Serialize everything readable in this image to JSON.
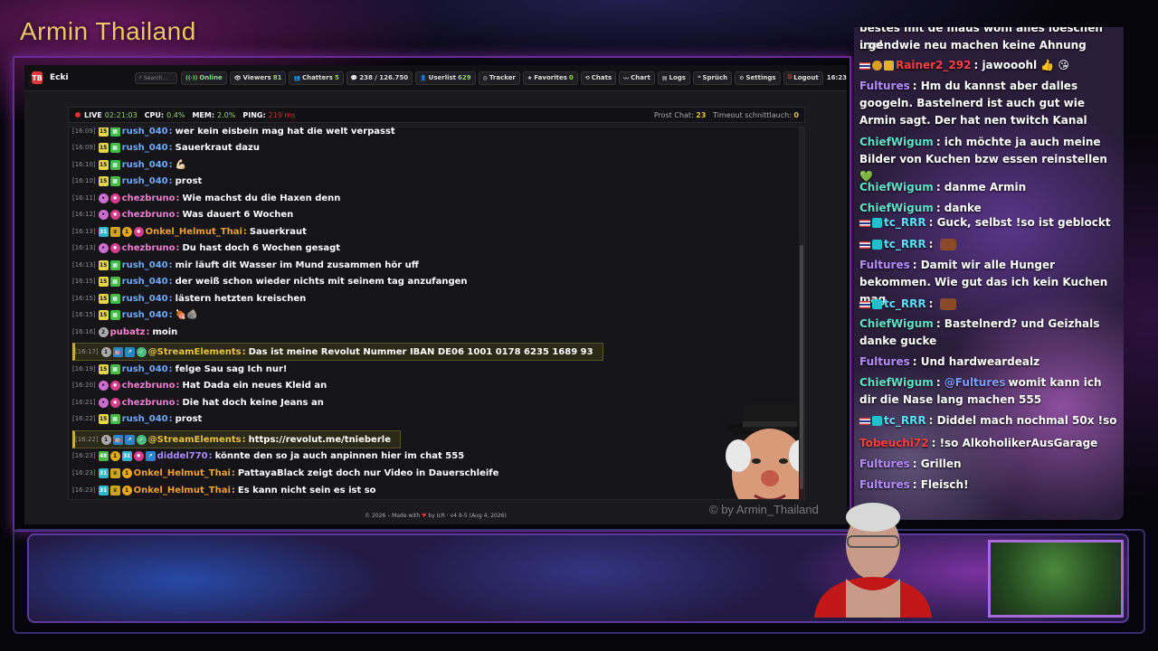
{
  "title": "Armin Thailand",
  "app": {
    "name": "Ecki",
    "logo": "TB",
    "search_placeholder": "Search...",
    "toolbar": [
      {
        "label": "Online",
        "icon": "signal-icon",
        "name": "online"
      },
      {
        "label": "Viewers",
        "value": "81",
        "icon": "eye-icon",
        "name": "viewers"
      },
      {
        "label": "Chatters",
        "value": "5",
        "icon": "users-icon",
        "name": "chatters"
      },
      {
        "label": "238 / 126.750",
        "icon": "chat-icon",
        "name": "messages"
      },
      {
        "label": "Userlist",
        "value": "629",
        "icon": "user-icon",
        "name": "userlist"
      },
      {
        "label": "Tracker",
        "icon": "target-icon",
        "name": "tracker"
      },
      {
        "label": "Favorites",
        "value": "0",
        "icon": "star-icon",
        "name": "favorites"
      },
      {
        "label": "Chats",
        "icon": "history-icon",
        "name": "chats"
      },
      {
        "label": "Chart",
        "icon": "chart-icon",
        "name": "chart"
      },
      {
        "label": "Logs",
        "icon": "file-icon",
        "name": "logs"
      },
      {
        "label": "Sprüch",
        "icon": "quote-icon",
        "name": "sprueche"
      },
      {
        "label": "Settings",
        "icon": "gear-icon",
        "name": "settings"
      },
      {
        "label": "Logout",
        "icon": "logout-icon",
        "name": "logout"
      }
    ],
    "clock": "16:23"
  },
  "status": {
    "live": "LIVE",
    "uptime": "02:21:03",
    "cpu_label": "CPU:",
    "cpu": "0.4%",
    "mem_label": "MEM:",
    "mem": "2.0%",
    "ping_label": "PING:",
    "ping": "219 ms",
    "prost_label": "Prost Chat:",
    "prost": "23",
    "timeout_label": "Timeout schnittlauch:",
    "timeout": "0"
  },
  "chat": [
    {
      "ts": "[16:09]",
      "badges": [
        "sub15",
        "green"
      ],
      "user": "rush_040",
      "color": "#6fa8ff",
      "text": "wer kein eisbein mag hat die welt verpasst"
    },
    {
      "ts": "[16:09]",
      "badges": [
        "sub15",
        "green"
      ],
      "user": "rush_040",
      "color": "#6fa8ff",
      "text": "Sauerkraut dazu"
    },
    {
      "ts": "[16:10]",
      "badges": [
        "sub15",
        "green"
      ],
      "user": "rush_040",
      "color": "#6fa8ff",
      "text": "💪🏻"
    },
    {
      "ts": "[16:10]",
      "badges": [
        "sub15",
        "green"
      ],
      "user": "rush_040",
      "color": "#6fa8ff",
      "text": "prost"
    },
    {
      "ts": "[16:11]",
      "badges": [
        "pink",
        "star"
      ],
      "user": "chezbruno",
      "color": "#ee7fd0",
      "text": "Wie machst du die Haxen denn"
    },
    {
      "ts": "[16:12]",
      "badges": [
        "pink",
        "star"
      ],
      "user": "chezbruno",
      "color": "#ee7fd0",
      "text": "Was dauert 6 Wochen"
    },
    {
      "ts": "[16:13]",
      "badges": [
        "cyan",
        "crown",
        "gold",
        "star"
      ],
      "user": "Onkel_Helmut_Thai",
      "color": "#f0a030",
      "text": "Sauerkraut"
    },
    {
      "ts": "[16:13]",
      "badges": [
        "pink",
        "star"
      ],
      "user": "chezbruno",
      "color": "#ee7fd0",
      "text": "Du hast doch 6 Wochen gesagt"
    },
    {
      "ts": "[16:13]",
      "badges": [
        "sub15",
        "green"
      ],
      "user": "rush_040",
      "color": "#6fa8ff",
      "text": "mir läuft dit Wasser im Mund zusammen hör uff"
    },
    {
      "ts": "[16:15]",
      "badges": [
        "sub15",
        "green"
      ],
      "user": "rush_040",
      "color": "#6fa8ff",
      "text": "der weiß schon wieder nichts mit seinem tag anzufangen"
    },
    {
      "ts": "[16:15]",
      "badges": [
        "sub15",
        "green"
      ],
      "user": "rush_040",
      "color": "#6fa8ff",
      "text": "lästern hetzten kreischen"
    },
    {
      "ts": "[16:15]",
      "badges": [
        "sub15",
        "green"
      ],
      "user": "rush_040",
      "color": "#6fa8ff",
      "text": "🍖🪨"
    },
    {
      "ts": "[16:16]",
      "badges": [
        "gray2"
      ],
      "user": "pubatz",
      "color": "#ff7fd0",
      "text": "moin"
    },
    {
      "ts": "[16:17]",
      "badges": [
        "gray1",
        "blue",
        "blue2",
        "lime"
      ],
      "user": "@StreamElements",
      "color": "#e8c040",
      "text": "Das ist meine Revolut Nummer IBAN DE06 1001 0178 6235 1689 93",
      "hl": true
    },
    {
      "ts": "[16:19]",
      "badges": [
        "sub15",
        "green"
      ],
      "user": "rush_040",
      "color": "#6fa8ff",
      "text": "felge Sau sag Ich nur!"
    },
    {
      "ts": "[16:20]",
      "badges": [
        "pink",
        "star"
      ],
      "user": "chezbruno",
      "color": "#ee7fd0",
      "text": "Hat Dada ein neues Kleid an"
    },
    {
      "ts": "[16:21]",
      "badges": [
        "pink",
        "star"
      ],
      "user": "chezbruno",
      "color": "#ee7fd0",
      "text": "Die hat doch keine Jeans an"
    },
    {
      "ts": "[16:22]",
      "badges": [
        "sub15",
        "green"
      ],
      "user": "rush_040",
      "color": "#6fa8ff",
      "text": "prost"
    },
    {
      "ts": "[16:22]",
      "badges": [
        "gray1",
        "blue",
        "blue2",
        "lime"
      ],
      "user": "@StreamElements",
      "color": "#e8c040",
      "text": "https://revolut.me/tnieberle",
      "hl": true
    },
    {
      "ts": "[16:23]",
      "badges": [
        "green48",
        "gold",
        "cyan",
        "star",
        "blue2"
      ],
      "user": "diddel770",
      "color": "#a98cff",
      "text": "könnte den so ja auch anpinnen hier im chat 555"
    },
    {
      "ts": "[16:23]",
      "badges": [
        "cyan",
        "crown",
        "gold"
      ],
      "user": "Onkel_Helmut_Thai",
      "color": "#f0a030",
      "text": "PattayaBlack zeigt doch nur Video in Dauerschleife"
    },
    {
      "ts": "[16:23]",
      "badges": [
        "cyan",
        "crown",
        "gold"
      ],
      "user": "Onkel_Helmut_Thai",
      "color": "#f0a030",
      "text": "Es kann nicht sein es ist so"
    }
  ],
  "footer": {
    "pre": "© 2026 – Made with",
    "heart": "♥",
    "post": "by IcR · v4.9-5 (Aug 4, 2026)"
  },
  "watermark": "© by Armin_Thailand",
  "side_chat": [
    {
      "user": "",
      "text": "bestes mit de maus wohl alles loeschen und",
      "cut": true
    },
    {
      "user": "",
      "text": "irgendwie neu machen keine Ahnung"
    },
    {
      "user": "Rainer2_292",
      "color": "#ff4040",
      "prefix": "flag-g-y",
      "text": "jawooohl 👍 😘"
    },
    {
      "user": "Fultures",
      "color": "#b58cff",
      "text": "Hm du kannst aber dalles googeln. Bastelnerd ist auch gut wie Armin sagt. Der hat nen twitch Kanal"
    },
    {
      "user": "ChiefWigum",
      "color": "#5fe0c8",
      "text": "ich möchte ja auch meine Bilder von Kuchen bzw essen reinstellen 💚"
    },
    {
      "user": "ChiefWigum",
      "color": "#5fe0c8",
      "text": "danme Armin"
    },
    {
      "user": "ChiefWigum",
      "color": "#5fe0c8",
      "text": "danke"
    },
    {
      "user": "tc_RRR",
      "color": "#5fe0ff",
      "prefix": "flag-c",
      "text": "Guck, selbst !so ist geblockt"
    },
    {
      "user": "tc_RRR",
      "color": "#5fe0ff",
      "prefix": "flag-c",
      "text": "",
      "emote": true
    },
    {
      "user": "Fultures",
      "color": "#b58cff",
      "text": "Damit wir alle Hunger bekommen. Wie gut das ich kein Kuchen mag"
    },
    {
      "user": "tc_RRR",
      "color": "#5fe0ff",
      "prefix": "flag-c",
      "text": "",
      "emote": true
    },
    {
      "user": "ChiefWigum",
      "color": "#5fe0c8",
      "text": "Bastelnerd? und Geizhals danke gucke"
    },
    {
      "user": "Fultures",
      "color": "#b58cff",
      "text": "Und hardweardealz"
    },
    {
      "user": "ChiefWigum",
      "color": "#5fe0c8",
      "mention": "@Fultures",
      "text": "womit kann ich dir die Nase lang machen 555"
    },
    {
      "user": "tc_RRR",
      "color": "#5fe0ff",
      "prefix": "flag-c",
      "text": "Diddel mach nochmal 50x !so"
    },
    {
      "user": "Tobeuchi72",
      "color": "#ff4040",
      "text": "!so AlkoholikerAusGarage"
    },
    {
      "user": "Fultures",
      "color": "#b58cff",
      "text": "Grillen"
    },
    {
      "user": "Fultures",
      "color": "#b58cff",
      "text": "Fleisch!"
    }
  ]
}
